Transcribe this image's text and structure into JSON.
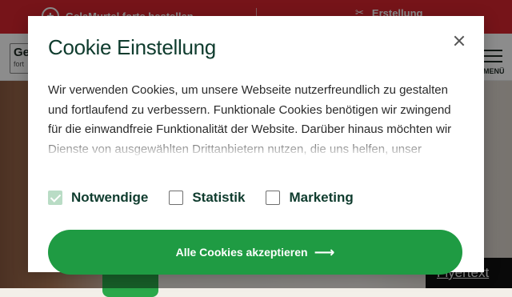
{
  "topbar": {
    "promo_label": "GelaMurtel forte bestellen",
    "create_label": "Erstellung",
    "promo_icon": "pill-icon",
    "create_icon": "scissors-icon"
  },
  "header": {
    "logo_line1": "Ge",
    "logo_line2": "fort",
    "menu_label": "MENÜ"
  },
  "flyer_button": "Flyertext",
  "modal": {
    "title": "Cookie Einstellung",
    "text": "Wir verwenden Cookies, um unsere Webseite nutzerfreundlich zu gestalten und fortlaufend zu verbessern. Funktionale Cookies benötigen wir zwingend für die einwandfreie Funktionalität der Website. Darüber hinaus möchten wir Dienste von ausgewählten Drittanbietern nutzen, die uns helfen, unser",
    "options": [
      {
        "label": "Notwendige",
        "checked": true
      },
      {
        "label": "Statistik",
        "checked": false
      },
      {
        "label": "Marketing",
        "checked": false
      }
    ],
    "accept_label": "Alle Cookies akzeptieren"
  },
  "colors": {
    "brand_red": "#d7262f",
    "accent_green": "#1f9b43",
    "title_green": "#0f3c2e"
  }
}
